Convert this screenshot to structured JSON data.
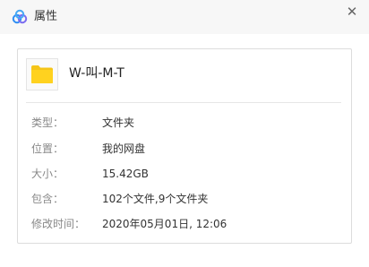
{
  "window": {
    "title": "属性",
    "close_glyph": "✕",
    "app_icon": "cloud-logo-icon"
  },
  "file": {
    "name": "W-叫-M-T",
    "icon": "folder-icon"
  },
  "properties": [
    {
      "label": "类型：",
      "value": "文件夹"
    },
    {
      "label": "位置：",
      "value": "我的网盘"
    },
    {
      "label": "大小：",
      "value": "15.42GB"
    },
    {
      "label": "包含：",
      "value": "102个文件,9个文件夹"
    },
    {
      "label": "修改时间：",
      "value": "2020年05月01日, 12:06"
    }
  ],
  "colors": {
    "folder": "#f5c518",
    "logo_blue": "#2f8ef4",
    "logo_purple": "#7b6cf0"
  }
}
